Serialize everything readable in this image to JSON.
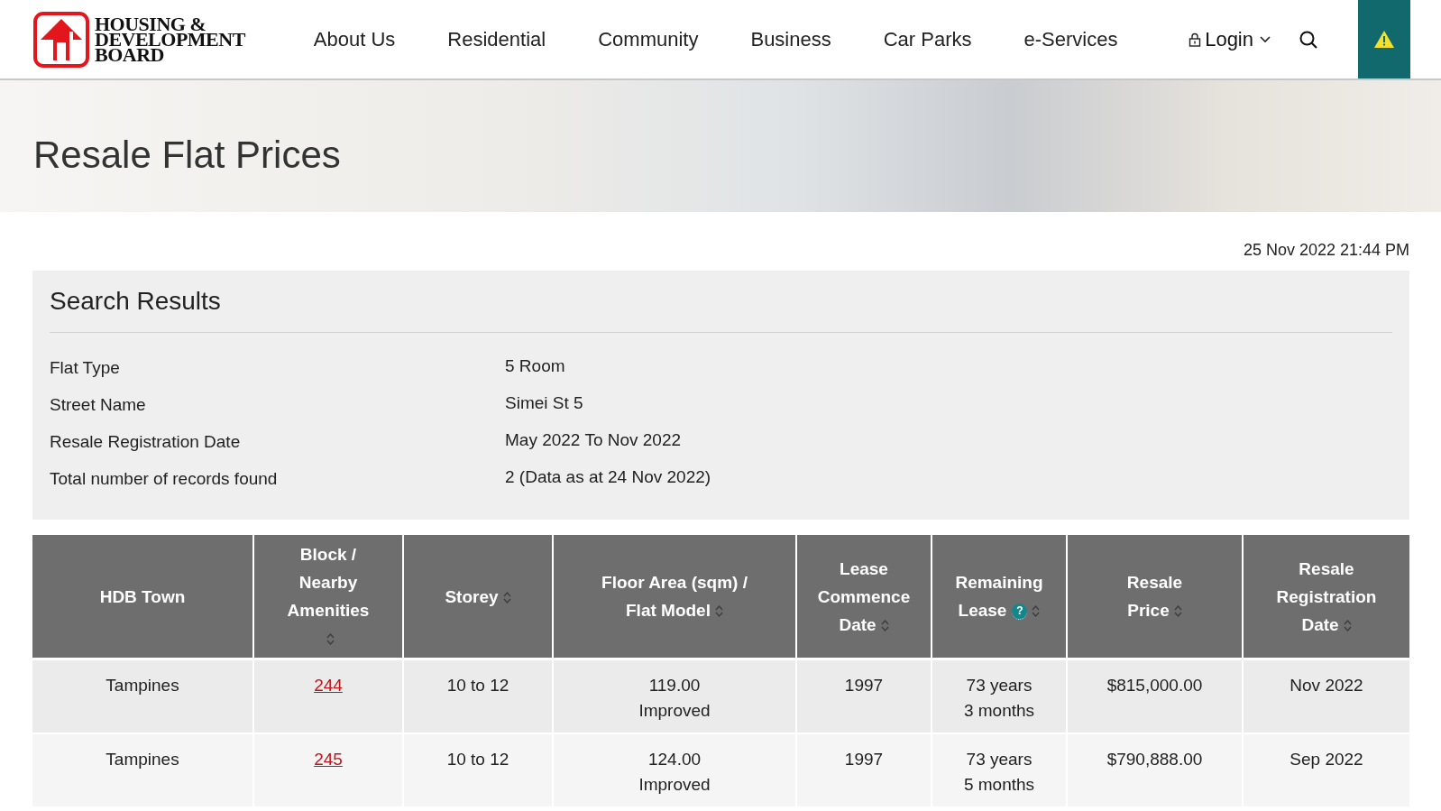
{
  "header": {
    "logo_text": [
      "HOUSING &",
      "DEVELOPMENT",
      "BOARD"
    ],
    "nav": [
      "About Us",
      "Residential",
      "Community",
      "Business",
      "Car Parks",
      "e-Services"
    ],
    "login": "Login"
  },
  "hero": {
    "title": "Resale Flat Prices"
  },
  "timestamp": "25 Nov 2022 21:44 PM",
  "results": {
    "title": "Search Results",
    "fields": [
      {
        "label": "Flat Type",
        "value": "5 Room"
      },
      {
        "label": "Street Name",
        "value": "Simei St 5"
      },
      {
        "label": "Resale Registration Date",
        "value": "May 2022 To Nov 2022"
      },
      {
        "label": "Total number of records found",
        "value": "2 (Data as at 24 Nov 2022)"
      }
    ]
  },
  "table": {
    "columns": [
      {
        "lines": [
          "HDB Town"
        ],
        "sortable": false,
        "help": false
      },
      {
        "lines": [
          "Block /",
          "Nearby",
          "Amenities"
        ],
        "sortable": true,
        "help": false
      },
      {
        "lines": [
          "Storey"
        ],
        "sortable": true,
        "help": false
      },
      {
        "lines": [
          "Floor Area (sqm) /",
          "Flat Model"
        ],
        "sortable": true,
        "help": false
      },
      {
        "lines": [
          "Lease",
          "Commence",
          "Date"
        ],
        "sortable": true,
        "help": false
      },
      {
        "lines": [
          "Remaining",
          "Lease"
        ],
        "sortable": true,
        "help": true,
        "help_text": "?"
      },
      {
        "lines": [
          "Resale",
          "Price"
        ],
        "sortable": true,
        "help": false
      },
      {
        "lines": [
          "Resale",
          "Registration",
          "Date"
        ],
        "sortable": true,
        "help": false
      }
    ],
    "rows": [
      {
        "cells": [
          {
            "kind": "text",
            "lines": [
              "Tampines"
            ]
          },
          {
            "kind": "link",
            "lines": [
              "244"
            ]
          },
          {
            "kind": "text",
            "lines": [
              "10 to 12"
            ]
          },
          {
            "kind": "text",
            "lines": [
              "119.00",
              "Improved"
            ]
          },
          {
            "kind": "text",
            "lines": [
              "1997"
            ]
          },
          {
            "kind": "text",
            "lines": [
              "73 years",
              "3 months"
            ]
          },
          {
            "kind": "text",
            "lines": [
              "$815,000.00"
            ]
          },
          {
            "kind": "text",
            "lines": [
              "Nov 2022"
            ]
          }
        ]
      },
      {
        "cells": [
          {
            "kind": "text",
            "lines": [
              "Tampines"
            ]
          },
          {
            "kind": "link",
            "lines": [
              "245"
            ]
          },
          {
            "kind": "text",
            "lines": [
              "10 to 12"
            ]
          },
          {
            "kind": "text",
            "lines": [
              "124.00",
              "Improved"
            ]
          },
          {
            "kind": "text",
            "lines": [
              "1997"
            ]
          },
          {
            "kind": "text",
            "lines": [
              "73 years",
              "5 months"
            ]
          },
          {
            "kind": "text",
            "lines": [
              "$790,888.00"
            ]
          },
          {
            "kind": "text",
            "lines": [
              "Sep 2022"
            ]
          }
        ]
      }
    ]
  }
}
